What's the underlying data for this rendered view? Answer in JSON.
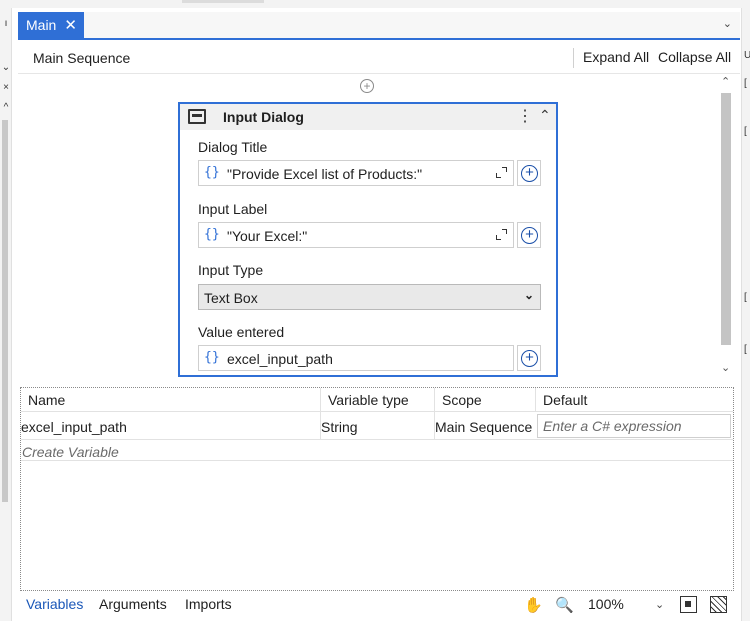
{
  "tab": {
    "label": "Main",
    "close_glyph": "✕"
  },
  "header": {
    "title": "Main Sequence",
    "expand_all": "Expand All",
    "collapse_all": "Collapse All"
  },
  "activity": {
    "title": "Input Dialog",
    "icon": "dialog-window-icon",
    "fields": [
      {
        "label": "Dialog Title",
        "value": "\"Provide Excel list of Products:\""
      },
      {
        "label": "Input Label",
        "value": "\"Your Excel:\""
      },
      {
        "label": "Input Type",
        "value": "Text Box"
      },
      {
        "label": "Value entered",
        "value": "excel_input_path"
      }
    ]
  },
  "variables": {
    "columns": [
      "Name",
      "Variable type",
      "Scope",
      "Default"
    ],
    "rows": [
      {
        "name": "excel_input_path",
        "type": "String",
        "scope": "Main Sequence",
        "default_placeholder": "Enter a C# expression"
      }
    ],
    "create_label": "Create Variable"
  },
  "bottom_tabs": [
    "Variables",
    "Arguments",
    "Imports"
  ],
  "zoom": "100%",
  "colors": {
    "accent": "#2f6fd6",
    "link": "#1a57b8"
  }
}
